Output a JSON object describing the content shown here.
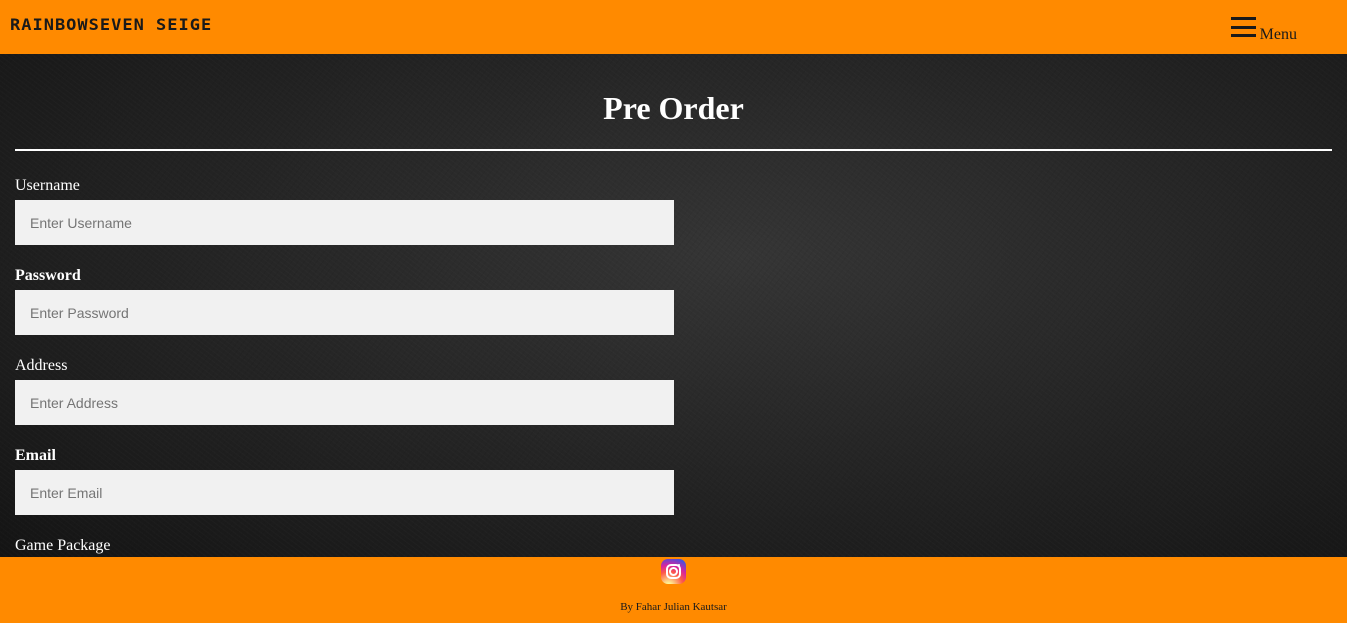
{
  "header": {
    "logo_text": "RAINBOWSEVEN SEIGE",
    "menu_label": "Menu"
  },
  "form": {
    "title": "Pre Order",
    "fields": [
      {
        "label": "Username",
        "placeholder": "Enter Username",
        "value": ""
      },
      {
        "label": "Password",
        "placeholder": "Enter Password",
        "value": ""
      },
      {
        "label": "Address",
        "placeholder": "Enter Address",
        "value": ""
      },
      {
        "label": "Email",
        "placeholder": "Enter Email",
        "value": ""
      }
    ],
    "game_package_label": "Game Package"
  },
  "footer": {
    "social_icon": "instagram-icon",
    "credit": "By Fahar Julian Kautsar"
  },
  "colors": {
    "accent": "#ff8a00",
    "background": "#262626",
    "input_bg": "#f1f1f1"
  }
}
